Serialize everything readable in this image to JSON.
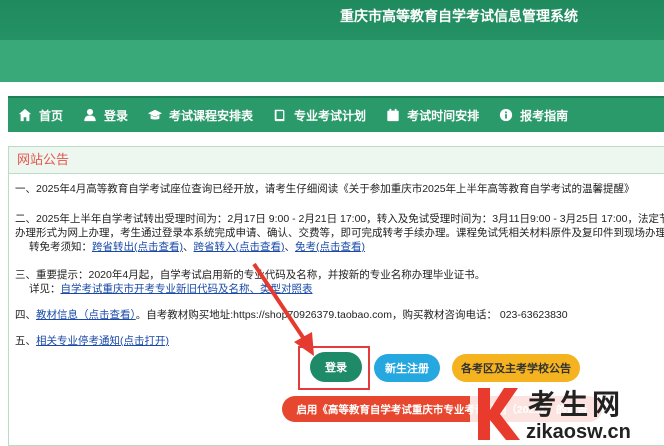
{
  "header": {
    "title": "重庆市高等教育自学考试信息管理系统"
  },
  "nav": {
    "items": [
      {
        "label": "首页",
        "icon": "home-icon"
      },
      {
        "label": "登录",
        "icon": "user-icon"
      },
      {
        "label": "考试课程安排表",
        "icon": "graduation-cap-icon"
      },
      {
        "label": "专业考试计划",
        "icon": "book-icon"
      },
      {
        "label": "考试时间安排",
        "icon": "calendar-icon"
      },
      {
        "label": "报考指南",
        "icon": "info-icon"
      }
    ]
  },
  "notice": {
    "title": "网站公告",
    "l1": "一、2025年4月高等教育自学考试座位查询已经开放，请考生仔细阅读《关于参加重庆市2025年上半年高等教育自学考试的温馨提醒》",
    "l2a": "二、2025年上半年自学考试转出受理时间为：2月17日 9:00 - 2月21日 17:00，转入及免试受理时间为：3月11日9:00 - 3月25日 17:00，法定节",
    "l2b": "办理形式为网上办理，考生通过登录本系统完成申请、确认、交费等，即可完成转考手续办理。课程免试凭相关材料原件及复印件到现场办理",
    "l2c_prefix": "转免考须知：",
    "l2c_link1": "跨省转出(点击查看)",
    "l2c_sep1": "、",
    "l2c_link2": "跨省转入(点击查看)",
    "l2c_sep2": "、",
    "l2c_link3": "免考(点击查看)",
    "l3a": "三、重要提示：2020年4月起，自学考试启用新的专业代码及名称，并按新的专业名称办理毕业证书。",
    "l3b_prefix": "详见：",
    "l3b_link": "自学考试重庆市开考专业新旧代码及名称、类型对照表",
    "l4_prefix": "四、",
    "l4_link": "教材信息（点击查看）",
    "l4_suffix": "。自考教材购买地址:https://shop70926379.taobao.com，购买教材咨询电话： 023-63623830",
    "l5_prefix": "五、",
    "l5_link": "相关专业停考通知(点击打开)"
  },
  "buttons": {
    "login": "登录",
    "register": "新生注册",
    "exam_notice": "各考区及主考学校公告",
    "start": "启用《高等教育自学考试重庆市专业考试计划（2025）》的通告"
  },
  "watermark": {
    "brand": "考生网",
    "domain": "zikaosw.cn"
  },
  "colors": {
    "header": "#2a9a6b",
    "nav": "#2b9a6a",
    "notice_title": "#e2574c",
    "link": "#1a4aa8",
    "highlight": "#e23c3c"
  }
}
